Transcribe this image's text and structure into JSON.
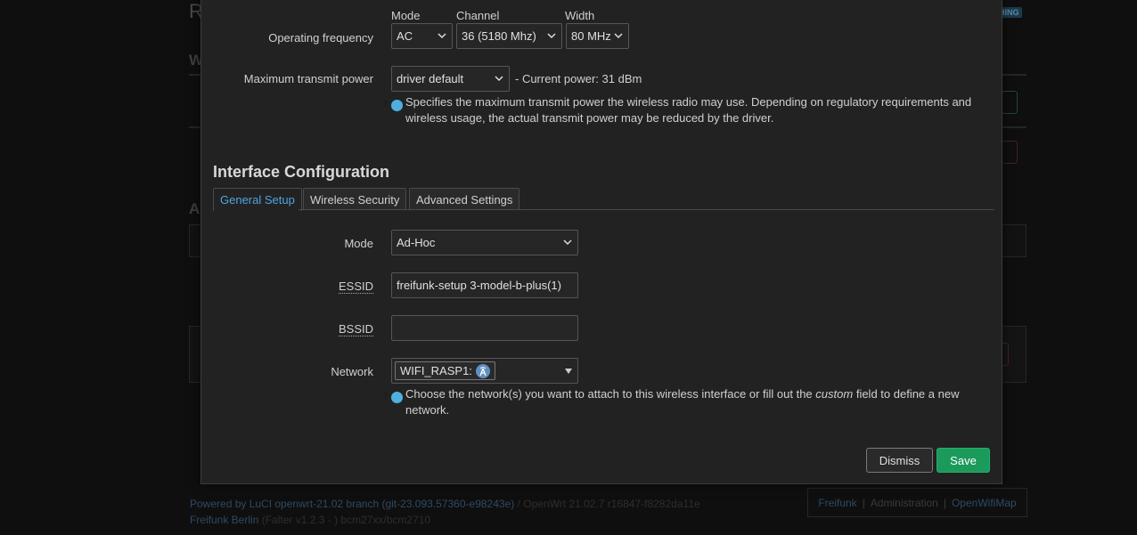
{
  "background": {
    "title_letter": "R",
    "section_letter_1": "W",
    "section_letter_2": "A",
    "badge": "HING",
    "footer_powered": "Powered by LuCI openwrt-21.02 branch (git-23.093.57360-e98243e)",
    "footer_openwrt": "/ OpenWrt 21.02.7 r16847-f8282da11e",
    "footer_freifunk": "Freifunk Berlin",
    "footer_build": "(Falter v1.2.3 - ) bcm27xx/bcm2710",
    "links": [
      "Freifunk",
      "Administration",
      "OpenWifiMap"
    ],
    "link_sep": "|"
  },
  "device": {
    "operating_frequency_label": "Operating frequency",
    "mode_label": "Mode",
    "mode_value": "AC",
    "channel_label": "Channel",
    "channel_value": "36 (5180 Mhz)",
    "width_label": "Width",
    "width_value": "80 MHz",
    "tx_power_label": "Maximum transmit power",
    "tx_power_value": "driver default",
    "current_power": "- Current power: 31 dBm",
    "tx_power_help": "Specifies the maximum transmit power the wireless radio may use. Depending on regulatory requirements and wireless usage, the actual transmit power may be reduced by the driver."
  },
  "interface": {
    "title": "Interface Configuration",
    "tabs": [
      {
        "label": "General Setup"
      },
      {
        "label": "Wireless Security"
      },
      {
        "label": "Advanced Settings"
      }
    ],
    "mode_label": "Mode",
    "mode_value": "Ad-Hoc",
    "essid_label": "ESSID",
    "essid_value": "freifunk-setup 3-model-b-plus(1)",
    "bssid_label": "BSSID",
    "bssid_value": "",
    "network_label": "Network",
    "network_value": "WIFI_RASP1:",
    "network_help_pre": "Choose the network(s) you want to attach to this wireless interface or fill out the",
    "network_help_em": "custom",
    "network_help_post": "field to define a new network."
  },
  "buttons": {
    "dismiss": "Dismiss",
    "save": "Save"
  },
  "colors": {
    "accent": "#4fa6de",
    "save": "#1b9a5c",
    "modal_bg": "#222222",
    "page_bg": "#0f0f0f"
  },
  "icons": {
    "chevron": "chevron-down-icon",
    "help": "help-icon",
    "network": "wireless-network-icon"
  }
}
